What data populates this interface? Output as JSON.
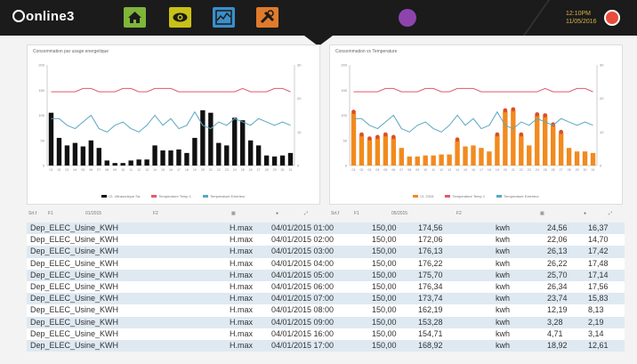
{
  "app": {
    "logo": "online3",
    "time": "12:10PM",
    "date": "11/05/2016"
  },
  "nav": [
    {
      "icon": "home-icon",
      "color": "#7fb539"
    },
    {
      "icon": "eye-icon",
      "color": "#c9c117"
    },
    {
      "icon": "chart-icon",
      "color": "#3b8fc9"
    },
    {
      "icon": "tools-icon",
      "color": "#e07b2c"
    }
  ],
  "left_panel": {
    "title": "Consommation par usage energetique",
    "legend": [
      "Ct. Ultrasonique Sa",
      "Temperature Temp 1",
      "Temperature Exterieur"
    ],
    "toolbar": [
      "Srt.f",
      "F1",
      "01/2015",
      "F2"
    ]
  },
  "right_panel": {
    "title": "Consommation vs Temperature",
    "legend": [
      "Ct. 2315",
      "Temperature Temp 1",
      "Temperature Exterieur"
    ],
    "toolbar": [
      "Srt.f",
      "F1",
      "05/2015",
      "F2"
    ]
  },
  "chart_data": [
    {
      "type": "bar",
      "title": "Consommation par usage energetique",
      "categories": [
        "01",
        "02",
        "03",
        "04",
        "05",
        "06",
        "07",
        "08",
        "09",
        "10",
        "11",
        "12",
        "13",
        "14",
        "15",
        "16",
        "17",
        "18",
        "19",
        "20",
        "21",
        "22",
        "23",
        "24",
        "25",
        "26",
        "27",
        "28",
        "29",
        "30",
        "31"
      ],
      "series": [
        {
          "name": "Ct. Ultrasonique Sa",
          "type": "bar",
          "color": "#111111",
          "values": [
            105,
            55,
            40,
            45,
            38,
            50,
            35,
            10,
            5,
            5,
            10,
            12,
            12,
            40,
            30,
            30,
            32,
            25,
            55,
            110,
            105,
            45,
            40,
            95,
            90,
            50,
            40,
            20,
            18,
            20,
            25
          ]
        },
        {
          "name": "Temperature Temp 1",
          "type": "line",
          "color": "#e05a6b",
          "values": [
            22,
            22,
            22,
            22,
            23,
            23,
            22,
            22,
            22,
            23,
            23,
            22,
            22,
            23,
            23,
            23,
            22,
            22,
            22,
            22,
            22,
            22,
            22,
            22,
            23,
            22,
            22,
            22,
            23,
            23,
            22
          ]
        },
        {
          "name": "Temperature Exterieur",
          "type": "line",
          "color": "#5aa6c2",
          "values": [
            14,
            14,
            12,
            11,
            13,
            15,
            11,
            10,
            12,
            13,
            11,
            10,
            12,
            15,
            12,
            14,
            11,
            12,
            16,
            12,
            11,
            13,
            12,
            14,
            13,
            12,
            14,
            13,
            12,
            13,
            12
          ]
        }
      ],
      "ylim": [
        0,
        200
      ]
    },
    {
      "type": "bar",
      "title": "Consommation vs Temperature",
      "categories": [
        "01",
        "02",
        "03",
        "04",
        "05",
        "06",
        "07",
        "08",
        "09",
        "10",
        "11",
        "12",
        "13",
        "14",
        "15",
        "16",
        "17",
        "18",
        "19",
        "20",
        "21",
        "22",
        "23",
        "24",
        "25",
        "26",
        "27",
        "28",
        "29",
        "30",
        "31"
      ],
      "series": [
        {
          "name": "Ct. 2315",
          "type": "bar",
          "color": "#f28a1e",
          "values": [
            105,
            60,
            52,
            55,
            60,
            55,
            35,
            18,
            18,
            20,
            20,
            22,
            22,
            50,
            38,
            40,
            35,
            28,
            60,
            108,
            110,
            60,
            40,
            100,
            98,
            80,
            65,
            35,
            28,
            28,
            25
          ]
        },
        {
          "name": "Temperature Temp 1",
          "type": "line",
          "color": "#e05a6b",
          "values": [
            22,
            22,
            22,
            22,
            23,
            23,
            22,
            22,
            22,
            23,
            23,
            22,
            22,
            23,
            23,
            23,
            22,
            22,
            22,
            22,
            22,
            22,
            22,
            22,
            23,
            22,
            22,
            22,
            23,
            23,
            22
          ]
        },
        {
          "name": "Temperature Exterieur",
          "type": "line",
          "color": "#5aa6c2",
          "values": [
            14,
            14,
            12,
            11,
            13,
            15,
            11,
            10,
            12,
            13,
            11,
            10,
            12,
            15,
            12,
            14,
            11,
            12,
            16,
            12,
            11,
            13,
            12,
            14,
            13,
            12,
            14,
            13,
            12,
            13,
            12
          ]
        }
      ],
      "ylim": [
        0,
        200
      ]
    }
  ],
  "table": {
    "rows": [
      [
        "Dep_ELEC_Usine_KWH",
        "H.max",
        "04/01/2015 01:00",
        "150,00",
        "174,56",
        "kwh",
        "24,56",
        "16,37"
      ],
      [
        "Dep_ELEC_Usine_KWH",
        "H.max",
        "04/01/2015 02:00",
        "150,00",
        "172,06",
        "kwh",
        "22,06",
        "14,70"
      ],
      [
        "Dep_ELEC_Usine_KWH",
        "H.max",
        "04/01/2015 03:00",
        "150,00",
        "176,13",
        "kwh",
        "26,13",
        "17,42"
      ],
      [
        "Dep_ELEC_Usine_KWH",
        "H.max",
        "04/01/2015 04:00",
        "150,00",
        "176,22",
        "kwh",
        "26,22",
        "17,48"
      ],
      [
        "Dep_ELEC_Usine_KWH",
        "H.max",
        "04/01/2015 05:00",
        "150,00",
        "175,70",
        "kwh",
        "25,70",
        "17,14"
      ],
      [
        "Dep_ELEC_Usine_KWH",
        "H.max",
        "04/01/2015 06:00",
        "150,00",
        "176,34",
        "kwh",
        "26,34",
        "17,56"
      ],
      [
        "Dep_ELEC_Usine_KWH",
        "H.max",
        "04/01/2015 07:00",
        "150,00",
        "173,74",
        "kwh",
        "23,74",
        "15,83"
      ],
      [
        "Dep_ELEC_Usine_KWH",
        "H.max",
        "04/01/2015 08:00",
        "150,00",
        "162,19",
        "kwh",
        "12,19",
        "8,13"
      ],
      [
        "Dep_ELEC_Usine_KWH",
        "H.max",
        "04/01/2015 09:00",
        "150,00",
        "153,28",
        "kwh",
        "3,28",
        "2,19"
      ],
      [
        "Dep_ELEC_Usine_KWH",
        "H.max",
        "04/01/2015 16:00",
        "150,00",
        "154,71",
        "kwh",
        "4,71",
        "3,14"
      ],
      [
        "Dep_ELEC_Usine_KWH",
        "H.max",
        "04/01/2015 17:00",
        "150,00",
        "168,92",
        "kwh",
        "18,92",
        "12,61"
      ]
    ]
  }
}
